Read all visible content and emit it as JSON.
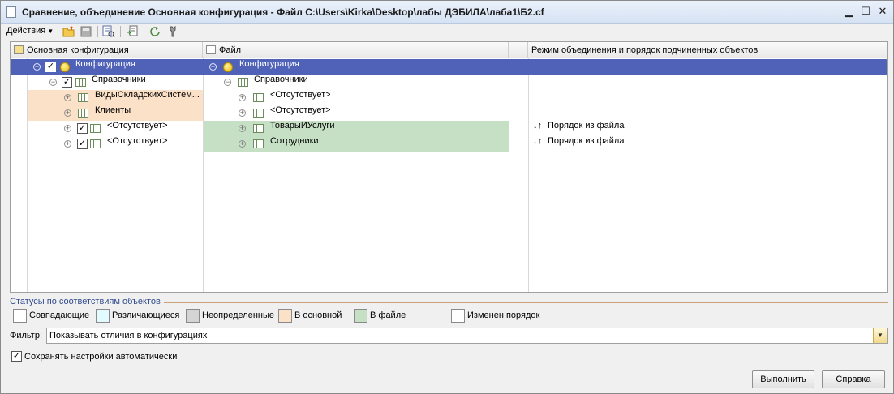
{
  "window": {
    "title": "Сравнение, объединение Основная конфигурация - Файл C:\\Users\\Kirka\\Desktop\\лабы ДЭБИЛА\\лаба1\\Б2.cf",
    "controls": {
      "minimize": "▁",
      "maximize": "☐",
      "close": "✕"
    }
  },
  "toolbar": {
    "actions_label": "Действия",
    "buttons": [
      "open-folder-icon",
      "save-icon",
      "compare-icon",
      "export-icon",
      "refresh-icon",
      "settings-icon"
    ]
  },
  "grid": {
    "columns": [
      {
        "label": "Основная конфигурация",
        "icon": "main-config-icon"
      },
      {
        "label": "Файл",
        "icon": "file-config-icon"
      },
      {
        "label": ""
      },
      {
        "label": "Режим объединения и порядок подчиненных объектов"
      }
    ],
    "rows": [
      {
        "main": "Конфигурация",
        "file": "Конфигурация",
        "mode": "",
        "selected": true
      },
      {
        "main": "Справочники",
        "file": "Справочники",
        "mode": ""
      },
      {
        "main": "ВидыСкладскихСистем...",
        "file": "<Отсутствует>",
        "mode": "",
        "status": "main"
      },
      {
        "main": "Клиенты",
        "file": "<Отсутствует>",
        "mode": "",
        "status": "main"
      },
      {
        "main": "<Отсутствует>",
        "file": "ТоварыИУслуги",
        "mode": "Порядок из файла",
        "status": "file"
      },
      {
        "main": "<Отсутствует>",
        "file": "Сотрудники",
        "mode": "Порядок из файла",
        "status": "file"
      }
    ]
  },
  "statuses": {
    "title": "Статусы по соответствиям объектов",
    "items": [
      {
        "label": "Совпадающие",
        "color": "#ffffff"
      },
      {
        "label": "Различающиеся",
        "color": "#e2fbff"
      },
      {
        "label": "Неопределенные",
        "color": "#d4d4d4"
      },
      {
        "label": "В основной",
        "color": "#fbe1c8"
      },
      {
        "label": "В файле",
        "color": "#c6e0c6"
      },
      {
        "label": "Изменен порядок",
        "color": "#ffffff"
      }
    ]
  },
  "filter": {
    "label": "Фильтр:",
    "value": "Показывать отличия в конфигурациях"
  },
  "autosave": {
    "label": "Сохранять настройки автоматически",
    "checked": true
  },
  "buttons": {
    "execute": "Выполнить",
    "help": "Справка"
  },
  "colors": {
    "selected_row": "#5062b8",
    "in_main": "#fbe1c8",
    "in_file": "#c6e0c6"
  }
}
